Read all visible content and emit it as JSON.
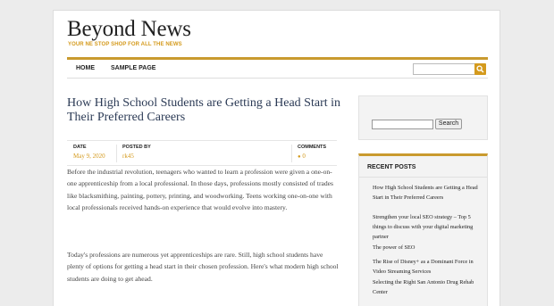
{
  "site": {
    "title": "Beyond News",
    "tagline": "YOUR NE STOP SHOP FOR ALL THE NEWS"
  },
  "nav": {
    "items": [
      "HOME",
      "SAMPLE PAGE"
    ],
    "search_placeholder": ""
  },
  "post": {
    "title": "How High School Students are Getting a Head Start in Their Preferred Careers",
    "meta": {
      "date_label": "DATE",
      "date": "May 9, 2020",
      "author_label": "POSTED BY",
      "author": "rk45",
      "comments_label": "COMMENTS",
      "comments": "0"
    },
    "paragraphs": [
      "Before the industrial revolution, teenagers who wanted to learn a profession were given a one-on-one apprenticeship from a local professional. In those days, professions mostly consisted of trades like blacksmithing, painting, pottery, printing, and woodworking. Teens working one-on-one with local professionals received hands-on experience that would evolve into mastery.",
      "Today's professions are numerous yet apprenticeships are rare. Still, high school students have plenty of options for getting a head start in their chosen profession. Here's what modern high school students are doing to get ahead."
    ]
  },
  "sidebar": {
    "search_button": "Search",
    "recent_heading": "RECENT POSTS",
    "recent_posts": [
      "How High School Students are Getting a Head Start in Their Preferred Careers",
      "Strengthen your local SEO strategy – Top 5 things to discuss with your digital marketing partner",
      "The power of SEO",
      "The Rise of Disney+ as a Dominant Force in Video Streaming Services",
      "Selecting the Right San Antonio Drug Rehab Center"
    ]
  },
  "colors": {
    "accent": "#d49a1d",
    "title": "#2b3a55"
  },
  "icons": {
    "search": "search-icon"
  }
}
